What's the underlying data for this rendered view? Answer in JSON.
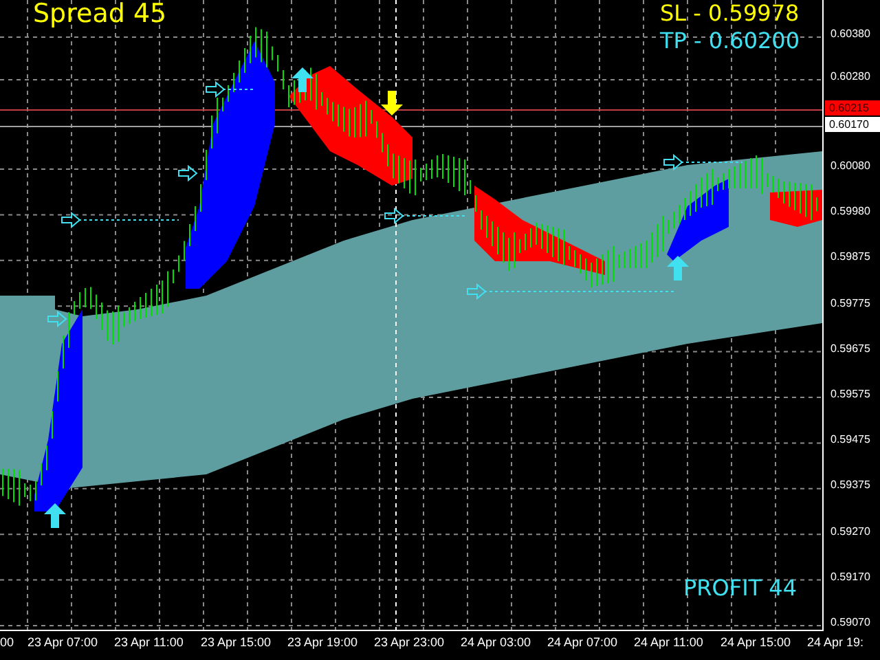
{
  "overlay": {
    "spread": "Spread 45",
    "sl": "SL - 0.59978",
    "tp": "TP - 0.60200",
    "profit": "PROFIT 44"
  },
  "y_axis": [
    "0.60380",
    "0.60280",
    "0.60080",
    "0.59980",
    "0.59875",
    "0.59775",
    "0.59675",
    "0.59575",
    "0.59475",
    "0.59375",
    "0.59270",
    "0.59170",
    "0.59070"
  ],
  "price_tags": [
    {
      "label": "0.60215",
      "kind": "bid"
    },
    {
      "label": "0.60170",
      "kind": "ask"
    }
  ],
  "x_axis": [
    "00",
    "23 Apr 07:00",
    "23 Apr 11:00",
    "23 Apr 15:00",
    "23 Apr 19:00",
    "23 Apr 23:00",
    "24 Apr 03:00",
    "24 Apr 07:00",
    "24 Apr 11:00",
    "24 Apr 15:00",
    "24 Apr 19:"
  ]
}
